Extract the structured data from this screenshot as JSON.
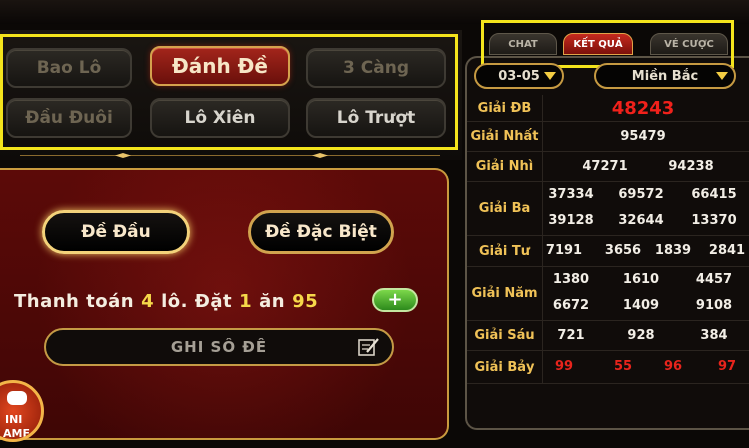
{
  "modes": [
    {
      "label": "Bao Lô",
      "state": "inactive"
    },
    {
      "label": "Đánh Đề",
      "state": "active"
    },
    {
      "label": "3 Càng",
      "state": "inactive"
    },
    {
      "label": "Đầu Đuôi",
      "state": "inactive"
    },
    {
      "label": "Lô Xiên",
      "state": "light"
    },
    {
      "label": "Lô Trượt",
      "state": "light"
    }
  ],
  "bet_types": [
    "Đề Đầu",
    "Đề Đặc Biệt"
  ],
  "payment": {
    "prefix": "Thanh toán",
    "count": "4",
    "middle": "lô. Đặt",
    "stake": "1",
    "an": "ăn",
    "payout": "95",
    "plus": "+"
  },
  "number_input": {
    "placeholder": "GHI SỐ ĐỀ",
    "value": ""
  },
  "mini_game": {
    "line1": "INI",
    "line2": "AME"
  },
  "tabs": [
    {
      "label": "CHAT",
      "active": false
    },
    {
      "label": "KẾT QUẢ",
      "active": true
    },
    {
      "label": "VÉ CƯỢC",
      "active": false
    }
  ],
  "date_select": "03-05",
  "region_select": "Miền Bắc",
  "results": [
    {
      "name": "Giải ĐB",
      "rows": [
        [
          "48243"
        ]
      ],
      "style": "db"
    },
    {
      "name": "Giải Nhất",
      "rows": [
        [
          "95479"
        ]
      ]
    },
    {
      "name": "Giải Nhì",
      "rows": [
        [
          "47271",
          "94238"
        ]
      ]
    },
    {
      "name": "Giải Ba",
      "rows": [
        [
          "37334",
          "69572",
          "66415"
        ],
        [
          "39128",
          "32644",
          "13370"
        ]
      ]
    },
    {
      "name": "Giải Tư",
      "rows": [
        [
          "7191",
          "3656",
          "1839",
          "2841"
        ]
      ]
    },
    {
      "name": "Giải Năm",
      "rows": [
        [
          "1380",
          "1610",
          "4457"
        ],
        [
          "6672",
          "1409",
          "9108"
        ]
      ]
    },
    {
      "name": "Giải Sáu",
      "rows": [
        [
          "721",
          "928",
          "384"
        ]
      ]
    },
    {
      "name": "Giải Bảy",
      "rows": [
        [
          "99",
          "55",
          "96",
          "97"
        ]
      ],
      "style": "red"
    }
  ],
  "colors": {
    "accent_gold": "#f0c257",
    "active_red": "#a3251b",
    "highlight_yellow": "#f4e41c"
  }
}
